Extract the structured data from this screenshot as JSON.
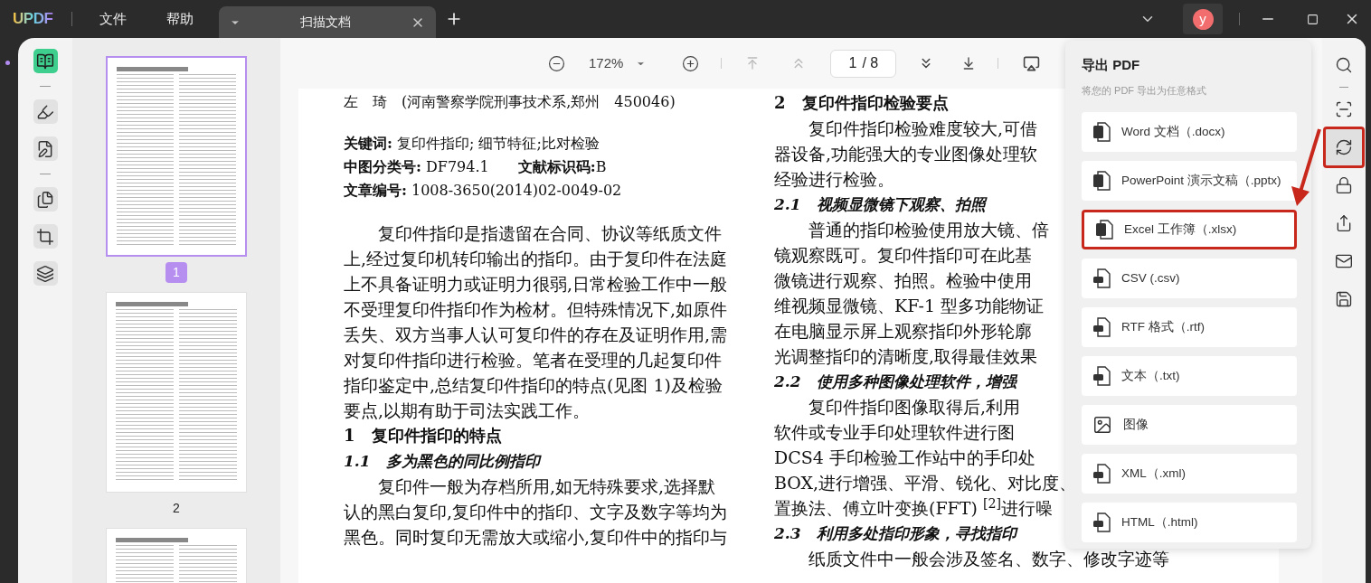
{
  "app": {
    "logo": "UPDF"
  },
  "menu": [
    {
      "label": "文件"
    },
    {
      "label": "帮助"
    }
  ],
  "tabs": [
    {
      "label": "扫描文档",
      "selected": true
    }
  ],
  "account": {
    "avatar": "y"
  },
  "left_tools": [
    [
      {
        "kind": "reader",
        "selected": true
      }
    ],
    [
      {
        "kind": "comment",
        "selected": false
      },
      {
        "kind": "edit",
        "selected": false
      }
    ],
    [
      {
        "kind": "pages",
        "selected": false
      },
      {
        "kind": "crop",
        "selected": false
      },
      {
        "kind": "overlay",
        "selected": false
      }
    ]
  ],
  "thumbnails": [
    {
      "page": "1",
      "selected": true
    },
    {
      "page": "2",
      "selected": false
    },
    {
      "selected": false
    }
  ],
  "toolbar": {
    "zoom": "172%",
    "page_field": "1",
    "page_total": "/ 8"
  },
  "document": {
    "left_column": [
      {
        "kind": "meta",
        "text": "左　琦　(河南警察学院刑事技术系,郑州　450046)"
      },
      {
        "kind": "gap"
      },
      {
        "kind": "meta",
        "text": "**关键词:** 复印件指印; 细节特征;比对检验"
      },
      {
        "kind": "meta",
        "text": "**中图分类号:** DF794.1　　**文献标识码:**B"
      },
      {
        "kind": "meta",
        "text": "**文章编号:** 1008-3650(2014)02-0049-02"
      },
      {
        "kind": "gap"
      },
      {
        "kind": "indent",
        "text": "复印件指印是指遗留在合同、协议等纸质文件"
      },
      {
        "kind": "body",
        "text": "上,经过复印机转印输出的指印。由于复印件在法庭"
      },
      {
        "kind": "body",
        "text": "上不具备证明力或证明力很弱,日常检验工作中一般"
      },
      {
        "kind": "body",
        "text": "不受理复印件指印作为检材。但特殊情况下,如原件"
      },
      {
        "kind": "body",
        "text": "丢失、双方当事人认可复印件的存在及证明作用,需"
      },
      {
        "kind": "body",
        "text": "对复印件指印进行检验。笔者在受理的几起复印件"
      },
      {
        "kind": "body",
        "text": "指印鉴定中,总结复印件指印的特点(见图 1)及检验"
      },
      {
        "kind": "body",
        "text": "要点,以期有助于司法实践工作。"
      },
      {
        "kind": "heading",
        "text": "1　复印件指印的特点"
      },
      {
        "kind": "subheading",
        "text": "1.1　多为黑色的同比例指印"
      },
      {
        "kind": "indent",
        "text": "复印件一般为存档所用,如无特殊要求,选择默"
      },
      {
        "kind": "body",
        "text": "认的黑白复印,复印件中的指印、文字及数字等均为"
      },
      {
        "kind": "body",
        "text": "黑色。同时复印无需放大或缩小,复印件中的指印与"
      }
    ],
    "right_column": [
      {
        "kind": "heading",
        "text": "2　复印件指印检验要点"
      },
      {
        "kind": "indent",
        "text": "复印件指印检验难度较大,可借"
      },
      {
        "kind": "body",
        "text": "器设备,功能强大的专业图像处理软"
      },
      {
        "kind": "body",
        "text": "经验进行检验。"
      },
      {
        "kind": "subheading",
        "text": "2.1　视频显微镜下观察、拍照"
      },
      {
        "kind": "indent",
        "text": "普通的指印检验使用放大镜、倍"
      },
      {
        "kind": "body",
        "text": "镜观察既可。复印件指印可在此基"
      },
      {
        "kind": "body",
        "text": "微镜进行观察、拍照。检验中使用"
      },
      {
        "kind": "body",
        "text": "维视频显微镜、KF-1 型多功能物证"
      },
      {
        "kind": "body",
        "text": "在电脑显示屏上观察指印外形轮廓"
      },
      {
        "kind": "body",
        "text": "光调整指印的清晰度,取得最佳效果"
      },
      {
        "kind": "subheading",
        "text": "2.2　使用多种图像处理软件，增强"
      },
      {
        "kind": "indent",
        "text": "复印件指印图像取得后,利用"
      },
      {
        "kind": "body",
        "text": "软件或专业手印处理软件进行图"
      },
      {
        "kind": "body",
        "text": "DCS4 手印检验工作站中的手印处"
      },
      {
        "kind": "body",
        "text": "BOX,进行增强、平滑、锐化、对比度、"
      },
      {
        "kind": "body",
        "text": "置换法、傅立叶变换(FFT) $^{[2]}$进行噪"
      },
      {
        "kind": "subheading",
        "text": "2.3　利用多处指印形象，寻找指印"
      },
      {
        "kind": "indent",
        "text": "纸质文件中一般会涉及签名、数字、修改字迹等"
      }
    ]
  },
  "export_panel": {
    "title": "导出 PDF",
    "subtitle": "将您的 PDF 导出为任意格式",
    "formats": [
      {
        "kind": "word",
        "label": "Word 文档（.docx)",
        "highlighted": false
      },
      {
        "kind": "powerpoint",
        "label": "PowerPoint 演示文稿（.pptx)",
        "highlighted": false
      },
      {
        "kind": "excel",
        "label": "Excel 工作簿（.xlsx)",
        "highlighted": true
      },
      {
        "kind": "csv",
        "label": "CSV (.csv)",
        "highlighted": false
      },
      {
        "kind": "rtf",
        "label": "RTF 格式（.rtf)",
        "highlighted": false
      },
      {
        "kind": "text",
        "label": "文本（.txt)",
        "highlighted": false
      },
      {
        "kind": "image",
        "label": "图像",
        "highlighted": false
      },
      {
        "kind": "xml",
        "label": "XML（.xml)",
        "highlighted": false
      },
      {
        "kind": "html",
        "label": "HTML（.html)",
        "highlighted": false
      }
    ]
  },
  "right_tools": [
    {
      "kind": "search",
      "selected": false,
      "highlighted": false
    },
    {
      "kind": "ocr",
      "selected": false,
      "highlighted": false
    },
    {
      "kind": "convert",
      "selected": true,
      "highlighted": true
    },
    {
      "kind": "protect",
      "selected": false,
      "highlighted": false
    },
    {
      "kind": "share",
      "selected": false,
      "highlighted": false
    },
    {
      "kind": "mail",
      "selected": false,
      "highlighted": false
    },
    {
      "kind": "save",
      "selected": false,
      "highlighted": false
    }
  ]
}
